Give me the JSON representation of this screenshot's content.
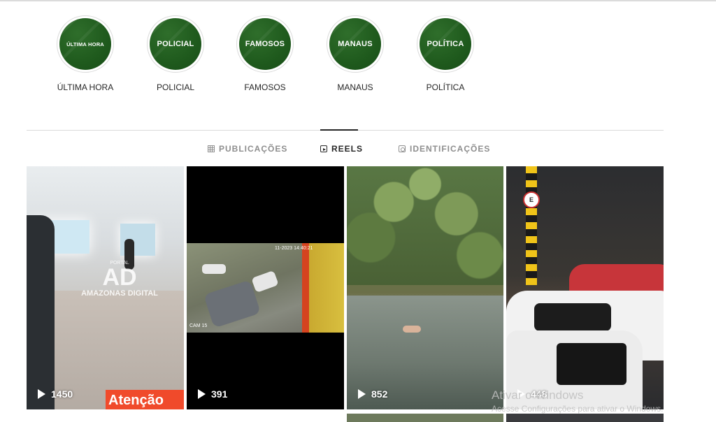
{
  "highlights": [
    {
      "circle_text": "ÚLTIMA HORA",
      "label": "ÚLTIMA HORA"
    },
    {
      "circle_text": "POLICIAL",
      "label": "POLICIAL"
    },
    {
      "circle_text": "FAMOSOS",
      "label": "FAMOSOS"
    },
    {
      "circle_text": "MANAUS",
      "label": "MANAUS"
    },
    {
      "circle_text": "POLÍTICA",
      "label": "POLÍTICA"
    }
  ],
  "tabs": [
    {
      "label": "PUBLICAÇÕES",
      "icon": "grid-icon",
      "active": false
    },
    {
      "label": "REELS",
      "icon": "reels-icon",
      "active": true
    },
    {
      "label": "IDENTIFICAÇÕES",
      "icon": "tagged-icon",
      "active": false
    }
  ],
  "reels": [
    {
      "views": "1450",
      "logo_top": "PORTAL",
      "logo_mark": "AD",
      "logo_name": "AMAZONAS DIGITAL",
      "banner": "Atenção"
    },
    {
      "views": "391",
      "timestamp": "11-2023 14:40:21",
      "cam_label": "CAM 15"
    },
    {
      "views": "852"
    },
    {
      "views": "448",
      "sign": "E"
    }
  ],
  "watermark": {
    "line1": "Ativar o Windows",
    "line2": "Acesse Configurações para ativar o Windows."
  },
  "colors": {
    "highlight_green": "#1f5a1d",
    "text": "#262626",
    "muted": "#8e8e8e",
    "divider": "#dbdbdb"
  }
}
